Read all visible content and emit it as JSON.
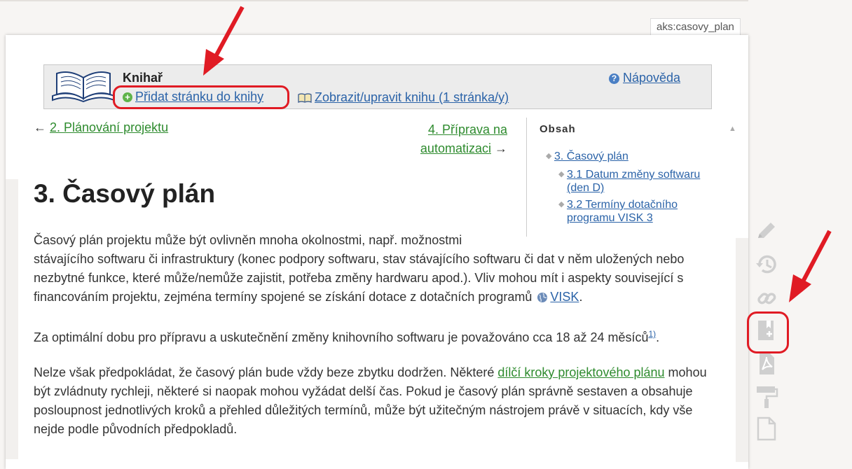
{
  "page_id": "aks:casovy_plan",
  "bookcreator": {
    "title": "Knihař",
    "add_page": "Přidat stránku do knihy",
    "view_book": "Zobrazit/upravit knihu (1 stránka/y)",
    "help": "Nápověda"
  },
  "nav": {
    "prev_arrow": "←",
    "prev_label": "2. Plánování projektu",
    "next_label_1": "4. Příprava na",
    "next_label_2": "automatizaci",
    "next_arrow": "→"
  },
  "toc": {
    "heading": "Obsah",
    "toggle": "▲",
    "items": [
      {
        "label": "3. Časový plán"
      },
      {
        "label_1": "3.1 Datum změny softwaru",
        "label_2": "(den D)"
      },
      {
        "label_1": "3.2 Termíny dotačního",
        "label_2": "programu VISK 3"
      }
    ]
  },
  "article": {
    "heading": "3. Časový plán",
    "p1_first": "Časový plán projektu může být ovlivněn mnoha okolnostmi, např. možnostmi",
    "p1_rest": "stávajícího softwaru či infrastruktury (konec podpory softwaru, stav stávajícího softwaru či dat v něm uložených nebo nezbytné funkce, které může/nemůže zajistit, potřeba změny hardwaru apod.). Vliv mohou mít i aspekty související s financováním projektu, zejména termíny spojené se získání dotace z dotačních programů",
    "p1_link": "VISK",
    "p1_end": ".",
    "p2_text": "Za optimální dobu pro přípravu a uskutečnění změny knihovního softwaru je považováno cca 18 až 24 měsíců",
    "p2_footnote": "1)",
    "p2_end": ".",
    "p3_start": "Nelze však předpokládat, že časový plán bude vždy beze zbytku dodržen. Některé",
    "p3_link": "dílčí kroky projektového plánu",
    "p3_rest": "mohou být zvládnuty rychleji, některé si naopak mohou vyžádat delší čas. Pokud je časový plán správně sestaven a obsahuje posloupnost jednotlivých kroků a přehled důležitých termínů, může být užitečným nástrojem právě v situacích, kdy vše nejde podle původních předpokladů."
  },
  "tools": [
    "pencil-icon",
    "history-icon",
    "link-icon",
    "add-to-book-icon",
    "pdf-icon",
    "paint-roller-icon",
    "new-page-icon"
  ],
  "colors": {
    "annotation_red": "#e01b24",
    "link_blue": "#2b63a8",
    "link_green": "#2e8b2e"
  }
}
